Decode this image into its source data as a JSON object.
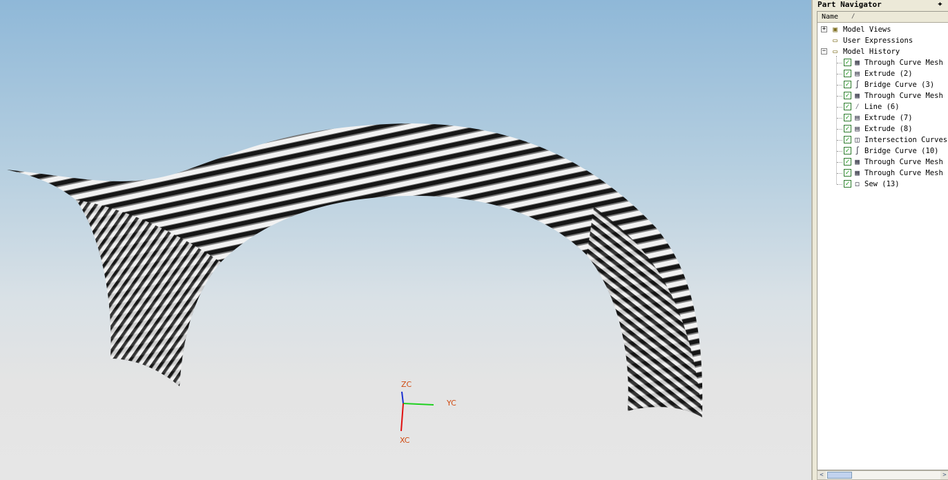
{
  "viewport": {
    "axes": {
      "z_label": "ZC",
      "y_label": "YC",
      "x_label": "XC"
    },
    "colors": {
      "z_axis": "#1a2fd0",
      "y_axis": "#1fd020",
      "x_axis": "#e01010",
      "label": "#d04a10"
    }
  },
  "navigator": {
    "title": "Part Navigator",
    "pin_icon": "pin-icon",
    "column_name": "Name",
    "sort_indicator": "/",
    "tree": [
      {
        "label": "Model Views",
        "expander": "+",
        "icon": "model-views-icon",
        "glyph": "▣"
      },
      {
        "label": "User Expressions",
        "expander": "",
        "icon": "folder-icon",
        "glyph": "▭"
      },
      {
        "label": "Model History",
        "expander": "−",
        "icon": "folder-open-icon",
        "glyph": "▭"
      }
    ],
    "history": [
      {
        "label": "Through Curve Mesh",
        "icon": "mesh-icon",
        "glyph": "▦"
      },
      {
        "label": "Extrude (2)",
        "icon": "extrude-icon",
        "glyph": "▤"
      },
      {
        "label": "Bridge Curve (3)",
        "icon": "bridge-curve-icon",
        "glyph": "∫"
      },
      {
        "label": "Through Curve Mesh",
        "icon": "mesh-icon",
        "glyph": "▦"
      },
      {
        "label": "Line (6)",
        "icon": "line-icon",
        "glyph": "⁄"
      },
      {
        "label": "Extrude (7)",
        "icon": "extrude-icon",
        "glyph": "▤"
      },
      {
        "label": "Extrude (8)",
        "icon": "extrude-icon",
        "glyph": "▤"
      },
      {
        "label": "Intersection Curves",
        "icon": "intersection-curve-icon",
        "glyph": "◫"
      },
      {
        "label": "Bridge Curve (10)",
        "icon": "bridge-curve-icon",
        "glyph": "∫"
      },
      {
        "label": "Through Curve Mesh",
        "icon": "mesh-icon",
        "glyph": "▦"
      },
      {
        "label": "Through Curve Mesh",
        "icon": "mesh-icon",
        "glyph": "▦"
      },
      {
        "label": "Sew (13)",
        "icon": "sew-icon",
        "glyph": "◻"
      }
    ],
    "checkbox_glyph": "✓",
    "scroll_left": "<",
    "scroll_right": ">"
  }
}
